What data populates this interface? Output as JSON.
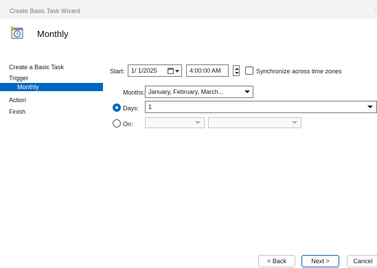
{
  "window": {
    "title": "Create Basic Task Wizard",
    "close_glyph": ":"
  },
  "header": {
    "title": "Monthly",
    "icon": "calendar-clock-icon"
  },
  "sidebar": {
    "items": [
      {
        "label": "Create a Basic Task",
        "selected": false
      },
      {
        "label": "Trigger",
        "selected": false
      },
      {
        "label": "Monthly",
        "selected": true
      },
      {
        "label": "Action",
        "selected": false
      },
      {
        "label": "Finish",
        "selected": false
      }
    ]
  },
  "start": {
    "label": "Start:",
    "date": "1/ 1/2025",
    "time": "4:00:00 AM",
    "sync_label": "Synchronize across time zones",
    "sync_checked": false
  },
  "months": {
    "label": "Months:",
    "value": "January, February, March..."
  },
  "days": {
    "label": "Days:",
    "value": "1",
    "selected": true
  },
  "on": {
    "label": "On:",
    "value1": "",
    "value2": "",
    "selected": false
  },
  "buttons": {
    "back": "< Back",
    "next": "Next >",
    "cancel": "Cancel"
  },
  "colors": {
    "accent": "#0067c0",
    "titlebar": "#f3f3f3"
  }
}
